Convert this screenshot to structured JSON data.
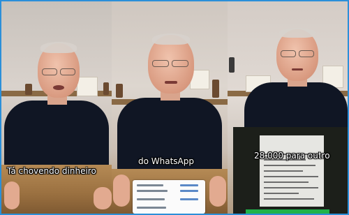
{
  "panels": [
    {
      "caption": "Tá chovendo dinheiro"
    },
    {
      "caption": "do WhatsApp"
    },
    {
      "caption": "28.000 para outro"
    }
  ],
  "colors": {
    "frame_border": "#2b8fd9",
    "shirt": "#101624",
    "receipt_highlight": "#20b24a"
  }
}
